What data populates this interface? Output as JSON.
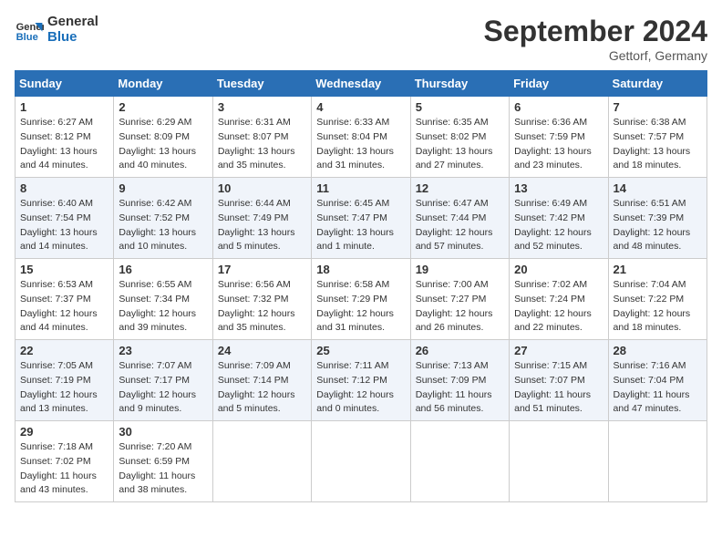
{
  "header": {
    "logo_line1": "General",
    "logo_line2": "Blue",
    "month": "September 2024",
    "location": "Gettorf, Germany"
  },
  "weekdays": [
    "Sunday",
    "Monday",
    "Tuesday",
    "Wednesday",
    "Thursday",
    "Friday",
    "Saturday"
  ],
  "weeks": [
    [
      {
        "day": "1",
        "sunrise": "6:27 AM",
        "sunset": "8:12 PM",
        "daylight": "13 hours and 44 minutes."
      },
      {
        "day": "2",
        "sunrise": "6:29 AM",
        "sunset": "8:09 PM",
        "daylight": "13 hours and 40 minutes."
      },
      {
        "day": "3",
        "sunrise": "6:31 AM",
        "sunset": "8:07 PM",
        "daylight": "13 hours and 35 minutes."
      },
      {
        "day": "4",
        "sunrise": "6:33 AM",
        "sunset": "8:04 PM",
        "daylight": "13 hours and 31 minutes."
      },
      {
        "day": "5",
        "sunrise": "6:35 AM",
        "sunset": "8:02 PM",
        "daylight": "13 hours and 27 minutes."
      },
      {
        "day": "6",
        "sunrise": "6:36 AM",
        "sunset": "7:59 PM",
        "daylight": "13 hours and 23 minutes."
      },
      {
        "day": "7",
        "sunrise": "6:38 AM",
        "sunset": "7:57 PM",
        "daylight": "13 hours and 18 minutes."
      }
    ],
    [
      {
        "day": "8",
        "sunrise": "6:40 AM",
        "sunset": "7:54 PM",
        "daylight": "13 hours and 14 minutes."
      },
      {
        "day": "9",
        "sunrise": "6:42 AM",
        "sunset": "7:52 PM",
        "daylight": "13 hours and 10 minutes."
      },
      {
        "day": "10",
        "sunrise": "6:44 AM",
        "sunset": "7:49 PM",
        "daylight": "13 hours and 5 minutes."
      },
      {
        "day": "11",
        "sunrise": "6:45 AM",
        "sunset": "7:47 PM",
        "daylight": "13 hours and 1 minute."
      },
      {
        "day": "12",
        "sunrise": "6:47 AM",
        "sunset": "7:44 PM",
        "daylight": "12 hours and 57 minutes."
      },
      {
        "day": "13",
        "sunrise": "6:49 AM",
        "sunset": "7:42 PM",
        "daylight": "12 hours and 52 minutes."
      },
      {
        "day": "14",
        "sunrise": "6:51 AM",
        "sunset": "7:39 PM",
        "daylight": "12 hours and 48 minutes."
      }
    ],
    [
      {
        "day": "15",
        "sunrise": "6:53 AM",
        "sunset": "7:37 PM",
        "daylight": "12 hours and 44 minutes."
      },
      {
        "day": "16",
        "sunrise": "6:55 AM",
        "sunset": "7:34 PM",
        "daylight": "12 hours and 39 minutes."
      },
      {
        "day": "17",
        "sunrise": "6:56 AM",
        "sunset": "7:32 PM",
        "daylight": "12 hours and 35 minutes."
      },
      {
        "day": "18",
        "sunrise": "6:58 AM",
        "sunset": "7:29 PM",
        "daylight": "12 hours and 31 minutes."
      },
      {
        "day": "19",
        "sunrise": "7:00 AM",
        "sunset": "7:27 PM",
        "daylight": "12 hours and 26 minutes."
      },
      {
        "day": "20",
        "sunrise": "7:02 AM",
        "sunset": "7:24 PM",
        "daylight": "12 hours and 22 minutes."
      },
      {
        "day": "21",
        "sunrise": "7:04 AM",
        "sunset": "7:22 PM",
        "daylight": "12 hours and 18 minutes."
      }
    ],
    [
      {
        "day": "22",
        "sunrise": "7:05 AM",
        "sunset": "7:19 PM",
        "daylight": "12 hours and 13 minutes."
      },
      {
        "day": "23",
        "sunrise": "7:07 AM",
        "sunset": "7:17 PM",
        "daylight": "12 hours and 9 minutes."
      },
      {
        "day": "24",
        "sunrise": "7:09 AM",
        "sunset": "7:14 PM",
        "daylight": "12 hours and 5 minutes."
      },
      {
        "day": "25",
        "sunrise": "7:11 AM",
        "sunset": "7:12 PM",
        "daylight": "12 hours and 0 minutes."
      },
      {
        "day": "26",
        "sunrise": "7:13 AM",
        "sunset": "7:09 PM",
        "daylight": "11 hours and 56 minutes."
      },
      {
        "day": "27",
        "sunrise": "7:15 AM",
        "sunset": "7:07 PM",
        "daylight": "11 hours and 51 minutes."
      },
      {
        "day": "28",
        "sunrise": "7:16 AM",
        "sunset": "7:04 PM",
        "daylight": "11 hours and 47 minutes."
      }
    ],
    [
      {
        "day": "29",
        "sunrise": "7:18 AM",
        "sunset": "7:02 PM",
        "daylight": "11 hours and 43 minutes."
      },
      {
        "day": "30",
        "sunrise": "7:20 AM",
        "sunset": "6:59 PM",
        "daylight": "11 hours and 38 minutes."
      },
      null,
      null,
      null,
      null,
      null
    ]
  ]
}
